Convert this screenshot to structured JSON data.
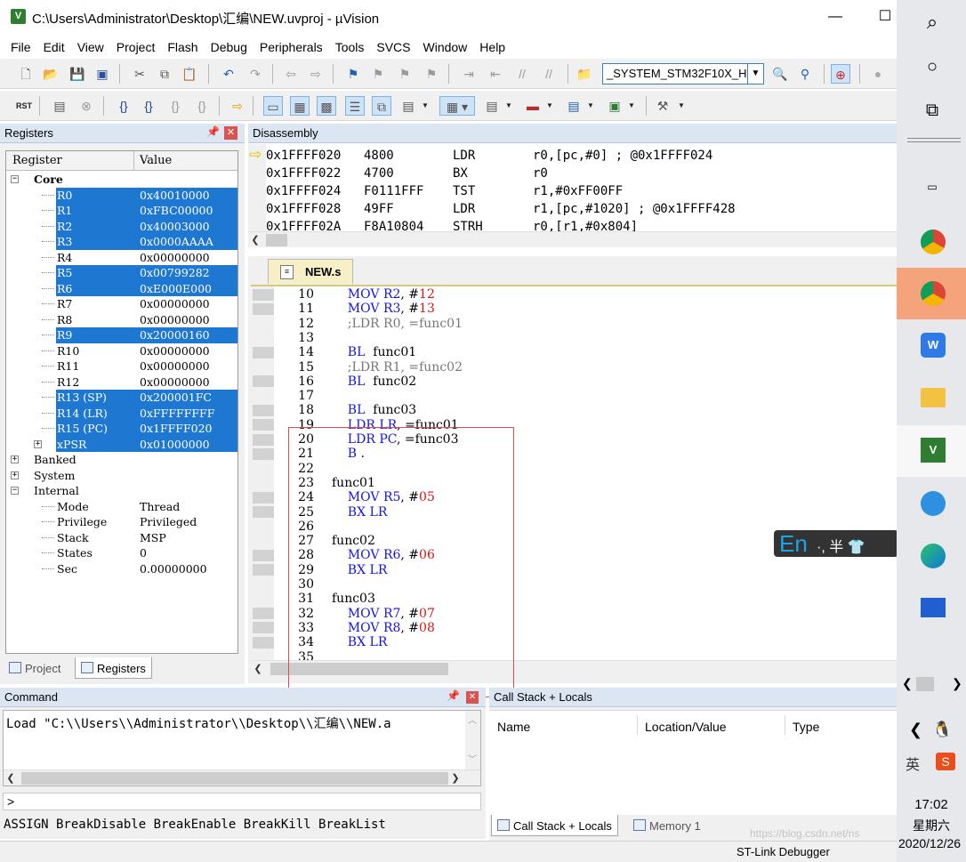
{
  "window": {
    "title": "C:\\Users\\Administrator\\Desktop\\汇编\\NEW.uvproj - µVision",
    "minimize_glyph": "—",
    "maximize_glyph": "☐"
  },
  "menu": [
    "File",
    "Edit",
    "View",
    "Project",
    "Flash",
    "Debug",
    "Peripherals",
    "Tools",
    "SVCS",
    "Window",
    "Help"
  ],
  "toolbar": {
    "target": "_SYSTEM_STM32F10X_H",
    "rst_label": "RST"
  },
  "registers_panel": {
    "title": "Registers",
    "columns": [
      "Register",
      "Value"
    ],
    "groups": {
      "core": "Core",
      "banked": "Banked",
      "system": "System",
      "internal": "Internal"
    },
    "core_rows": [
      {
        "name": "R0",
        "value": "0x40010000",
        "selected": true
      },
      {
        "name": "R1",
        "value": "0xFBC00000",
        "selected": true
      },
      {
        "name": "R2",
        "value": "0x40003000",
        "selected": true
      },
      {
        "name": "R3",
        "value": "0x0000AAAA",
        "selected": true
      },
      {
        "name": "R4",
        "value": "0x00000000",
        "selected": false
      },
      {
        "name": "R5",
        "value": "0x00799282",
        "selected": true
      },
      {
        "name": "R6",
        "value": "0xE000E000",
        "selected": true
      },
      {
        "name": "R7",
        "value": "0x00000000",
        "selected": false
      },
      {
        "name": "R8",
        "value": "0x00000000",
        "selected": false
      },
      {
        "name": "R9",
        "value": "0x20000160",
        "selected": true
      },
      {
        "name": "R10",
        "value": "0x00000000",
        "selected": false
      },
      {
        "name": "R11",
        "value": "0x00000000",
        "selected": false
      },
      {
        "name": "R12",
        "value": "0x00000000",
        "selected": false
      },
      {
        "name": "R13 (SP)",
        "value": "0x200001FC",
        "selected": true
      },
      {
        "name": "R14 (LR)",
        "value": "0xFFFFFFFF",
        "selected": true
      },
      {
        "name": "R15 (PC)",
        "value": "0x1FFFF020",
        "selected": true
      },
      {
        "name": "xPSR",
        "value": "0x01000000",
        "selected": true
      }
    ],
    "internal_rows": [
      {
        "name": "Mode",
        "value": "Thread"
      },
      {
        "name": "Privilege",
        "value": "Privileged"
      },
      {
        "name": "Stack",
        "value": "MSP"
      },
      {
        "name": "States",
        "value": "0"
      },
      {
        "name": "Sec",
        "value": "0.00000000"
      }
    ],
    "tabs": [
      "Project",
      "Registers"
    ]
  },
  "disassembly": {
    "title": "Disassembly",
    "rows": [
      {
        "addr": "0x1FFFF020",
        "code": "4800",
        "op": "LDR",
        "args": "r0,[pc,#0]  ; @0x1FFFF024",
        "current": true
      },
      {
        "addr": "0x1FFFF022",
        "code": "4700",
        "op": "BX",
        "args": "r0",
        "current": false
      },
      {
        "addr": "0x1FFFF024",
        "code": "F0111FFF",
        "op": "TST",
        "args": "r1,#0xFF00FF",
        "current": false
      },
      {
        "addr": "0x1FFFF028",
        "code": "49FF",
        "op": "LDR",
        "args": "r1,[pc,#1020]  ; @0x1FFFF428",
        "current": false
      },
      {
        "addr": "0x1FFFF02A",
        "code": "F8A10804",
        "op": "STRH",
        "args": "r0,[r1,#0x804]",
        "current": false
      }
    ]
  },
  "editor": {
    "tab": "NEW.s",
    "lines": [
      {
        "n": "10",
        "parts": [
          [
            "kw",
            "    MOV "
          ],
          [
            "rg",
            "R2"
          ],
          [
            "lbl",
            ", #"
          ],
          [
            "num",
            "12"
          ]
        ]
      },
      {
        "n": "11",
        "parts": [
          [
            "kw",
            "    MOV "
          ],
          [
            "rg",
            "R3"
          ],
          [
            "lbl",
            ", #"
          ],
          [
            "num",
            "13"
          ]
        ]
      },
      {
        "n": "12",
        "parts": [
          [
            "cm",
            "    ;LDR R0, =func01"
          ]
        ]
      },
      {
        "n": "13",
        "parts": []
      },
      {
        "n": "14",
        "parts": [
          [
            "kw",
            "    BL  "
          ],
          [
            "lbl",
            "func01"
          ]
        ]
      },
      {
        "n": "15",
        "parts": [
          [
            "cm",
            "    ;LDR R1, =func02"
          ]
        ]
      },
      {
        "n": "16",
        "parts": [
          [
            "kw",
            "    BL  "
          ],
          [
            "lbl",
            "func02"
          ]
        ]
      },
      {
        "n": "17",
        "parts": []
      },
      {
        "n": "18",
        "parts": [
          [
            "kw",
            "    BL  "
          ],
          [
            "lbl",
            "func03"
          ]
        ]
      },
      {
        "n": "19",
        "parts": [
          [
            "kw",
            "    LDR "
          ],
          [
            "rg",
            "LR"
          ],
          [
            "lbl",
            ", =func01"
          ]
        ]
      },
      {
        "n": "20",
        "parts": [
          [
            "kw",
            "    LDR "
          ],
          [
            "rg",
            "PC"
          ],
          [
            "lbl",
            ", =func03"
          ]
        ]
      },
      {
        "n": "21",
        "parts": [
          [
            "kw",
            "    B "
          ],
          [
            "lbl",
            "."
          ]
        ]
      },
      {
        "n": "22",
        "parts": []
      },
      {
        "n": "23",
        "parts": [
          [
            "lbl",
            "func01"
          ]
        ]
      },
      {
        "n": "24",
        "parts": [
          [
            "kw",
            "    MOV "
          ],
          [
            "rg",
            "R5"
          ],
          [
            "lbl",
            ", #"
          ],
          [
            "num",
            "05"
          ]
        ]
      },
      {
        "n": "25",
        "parts": [
          [
            "kw",
            "    BX "
          ],
          [
            "rg",
            "LR"
          ]
        ]
      },
      {
        "n": "26",
        "parts": []
      },
      {
        "n": "27",
        "parts": [
          [
            "lbl",
            "func02"
          ]
        ]
      },
      {
        "n": "28",
        "parts": [
          [
            "kw",
            "    MOV "
          ],
          [
            "rg",
            "R6"
          ],
          [
            "lbl",
            ", #"
          ],
          [
            "num",
            "06"
          ]
        ]
      },
      {
        "n": "29",
        "parts": [
          [
            "kw",
            "    BX "
          ],
          [
            "rg",
            "LR"
          ]
        ]
      },
      {
        "n": "30",
        "parts": []
      },
      {
        "n": "31",
        "parts": [
          [
            "lbl",
            "func03"
          ]
        ]
      },
      {
        "n": "32",
        "parts": [
          [
            "kw",
            "    MOV "
          ],
          [
            "rg",
            "R7"
          ],
          [
            "lbl",
            ", #"
          ],
          [
            "num",
            "07"
          ]
        ]
      },
      {
        "n": "33",
        "parts": [
          [
            "kw",
            "    MOV "
          ],
          [
            "rg",
            "R8"
          ],
          [
            "lbl",
            ", #"
          ],
          [
            "num",
            "08"
          ]
        ]
      },
      {
        "n": "34",
        "parts": [
          [
            "kw",
            "    BX "
          ],
          [
            "rg",
            "LR"
          ]
        ]
      },
      {
        "n": "35",
        "parts": []
      }
    ]
  },
  "command": {
    "title": "Command",
    "output": "Load \"C:\\\\Users\\\\Administrator\\\\Desktop\\\\汇编\\\\NEW.a",
    "prompt": ">",
    "help": "ASSIGN BreakDisable BreakEnable BreakKill BreakList"
  },
  "callstack": {
    "title": "Call Stack + Locals",
    "columns": [
      "Name",
      "Location/Value",
      "Type"
    ],
    "tabs": [
      "Call Stack + Locals",
      "Memory 1"
    ]
  },
  "status": {
    "debugger": "ST-Link Debugger",
    "watermark": "https://blog.csdn.net/ns"
  },
  "ime": {
    "lang": "En",
    "rest": "·, 半 👕"
  },
  "taskbar": {
    "time": "17:02",
    "weekday": "星期六",
    "date": "2020/12/26",
    "colors": {
      "chrome_active": "#f5a37a",
      "accent": "#0f6cbd"
    }
  }
}
